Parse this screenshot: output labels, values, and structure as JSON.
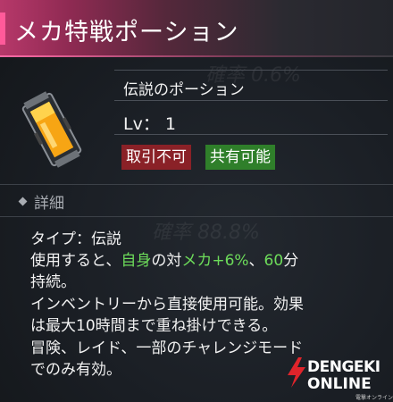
{
  "title": "メカ特戦ポーション",
  "item": {
    "name": "伝説のポーション",
    "level_label": "Lv",
    "level_value": "1",
    "tags": [
      "取引不可",
      "共有可能"
    ]
  },
  "details": {
    "header": "詳細",
    "type_line": "タイプ：伝説",
    "effect_line": {
      "prefix": "使用すると、",
      "hl1": "自身",
      "mid1": "の対",
      "hl2": "メカ",
      "plus": "+6%",
      "sep": "、",
      "hl3": "60",
      "suffix": "分"
    },
    "lines": [
      "持続。",
      "インベントリーから直接使用可能。効果",
      "は最大10時間まで重ね掛けできる。",
      "冒険、レイド、一部のチャレンジモード",
      "でのみ有効。"
    ]
  },
  "background_text": [
    "確率 0.6%",
    "確率 88.8%"
  ],
  "watermark": {
    "line1": "DENGEKI",
    "line2": "ONLINE",
    "line3": "電撃オンライン"
  },
  "colors": {
    "title_accent": "#ff5a9a",
    "tag_red": "#8a2127",
    "tag_green": "#2f7f2a",
    "highlight": "#6ddc5a"
  },
  "icons": [
    "potion-item-icon",
    "diamond-icon",
    "dengeki-logo-icon"
  ]
}
